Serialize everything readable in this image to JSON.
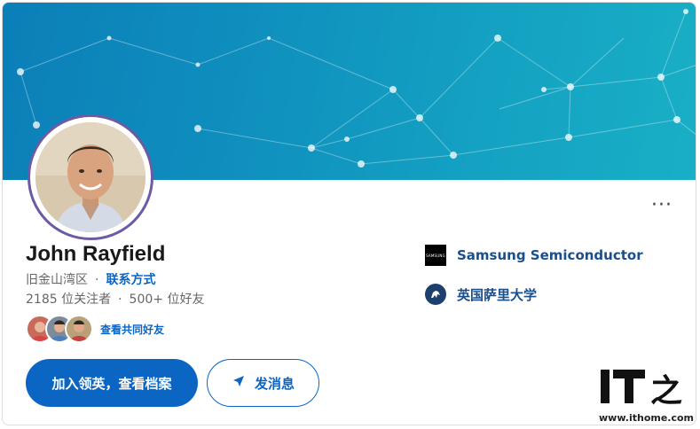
{
  "profile": {
    "name": "John Rayfield",
    "location": "旧金山湾区",
    "contact_label": "联系方式",
    "followers": "2185 位关注者",
    "connections": "500+ 位好友",
    "mutual_label": "查看共同好友",
    "more_label": "···"
  },
  "actions": {
    "primary_label": "加入领英，查看档案",
    "message_label": "发消息"
  },
  "organizations": [
    {
      "name": "Samsung Semiconductor",
      "logo_text": "SAMSUNG",
      "icon": "samsung-logo-icon"
    },
    {
      "name": "英国萨里大学",
      "icon": "university-of-surrey-logo-icon"
    }
  ],
  "watermark": {
    "brand": "IT之家",
    "url": "www.ithome.com"
  },
  "colors": {
    "accent": "#0a66c2",
    "banner_start": "#0b7fb8",
    "banner_end": "#19afc6",
    "org_text": "#1a4f8b",
    "avatar_ring": "#6c5aa5"
  }
}
